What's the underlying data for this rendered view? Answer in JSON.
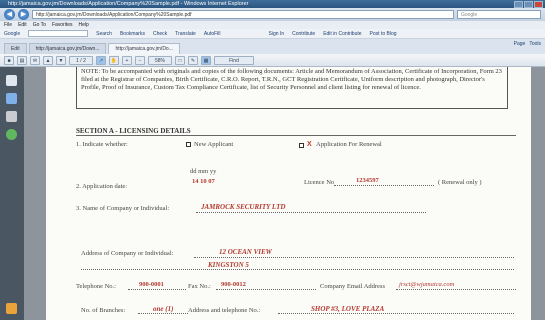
{
  "window": {
    "title": "http://jamaica.gov.jm/Downloads/Application/Company%20Sample.pdf - Windows Internet Explorer"
  },
  "address": {
    "url": "http://jamaica.gov.jm/Downloads/Application/Company%20Sample.pdf",
    "search_placeholder": "Google"
  },
  "menu": [
    "File",
    "Edit",
    "Go To",
    "Favorites",
    "Help"
  ],
  "google_bar": {
    "label": "Google",
    "items": [
      "Search",
      "Bookmarks",
      "Check",
      "Translate",
      "AutoFill"
    ],
    "right_items": [
      "Sign In",
      "Contribute",
      "Edit in Contribute",
      "Post to Blog"
    ]
  },
  "tabs": [
    {
      "label": "Edit"
    },
    {
      "label": "http://jamaica.gov.jm/Down..."
    },
    {
      "label": "http://jamaica.gov.jm/Do..."
    }
  ],
  "commands": [
    "Page",
    "Tools"
  ],
  "pdf_toolbar": {
    "page_label": "1 / 2",
    "zoom": "58%",
    "find": "Find"
  },
  "form": {
    "note": "NOTE: To be accompanied with originals and copies of the following documents: Article and Memorandum of Association, Certificate of Incorporation, Form 23 filed at the Registrar of Companies, Birth Certificate, C.R.O. Report, T.R.N., GCT Registration Certificate, Uniform description and photograph, Director's Profile, Proof of Insurance, Custom Tax Compliance Certificate, list of Security Personnel and client listing for renewal of licence.",
    "section_title": "SECTION A - LICENSING DETAILS",
    "indicate_label": "1. Indicate whether:",
    "new_applicant_label": "New Applicant",
    "renewal_x": "X",
    "renewal_label": "Application For Renewal",
    "date_format": "dd mm yy",
    "application_date_label": "2. Application date:",
    "application_date_value": "14 10 07",
    "licence_no_label": "Licence No",
    "licence_no_value": "1234597",
    "renewal_only": "( Renewal only )",
    "company_name_label": "3. Name of Company or Individual:",
    "company_name_value": "JAMROCK SECURITY LTD",
    "address_label": "Address of Company or Individual:",
    "address_line1": "12 OCEAN VIEW",
    "address_line2": "KINGSTON 5",
    "telephone_label": "Telephone No.:",
    "telephone_value": "900-0001",
    "fax_label": "Fax No.:",
    "fax_value": "900-0012",
    "email_label": "Company Email Address",
    "email_value": "jrsct@wjamaica.com",
    "branches_label": "No. of Branches:",
    "branches_value": "one (1)",
    "branch_address_label": "Address and telephone No.:",
    "branch_address_value": "SHOP #3, LOVE PLAZA"
  }
}
